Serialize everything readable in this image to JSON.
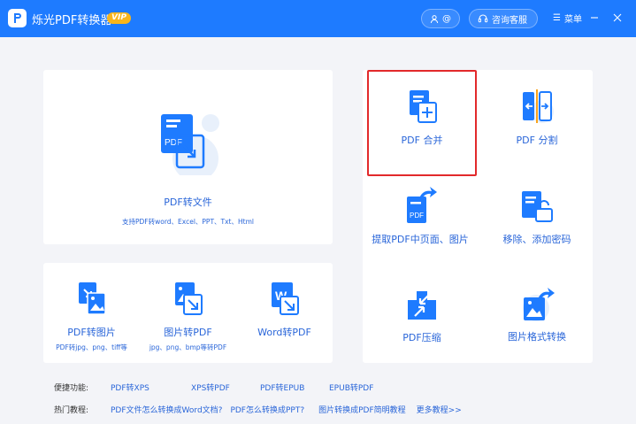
{
  "titlebar": {
    "app_title": "烁光PDF转换器",
    "vip_badge": "VIP",
    "account_label": "@",
    "support_label": "咨询客服",
    "menu_label": "菜单",
    "bg_color": "#1e7bff"
  },
  "main_card": {
    "label": "PDF转文件",
    "sub": "支持PDF转word、Excel、PPT、Txt、Html"
  },
  "small_tiles": [
    {
      "label": "PDF转图片",
      "sub": "PDF转jpg、png、tiff等"
    },
    {
      "label": "图片转PDF",
      "sub": "jpg、png、bmp等转PDF"
    },
    {
      "label": "Word转PDF",
      "sub": ""
    }
  ],
  "right_tiles": [
    {
      "label": "PDF 合并",
      "icon": "merge-pdf-icon"
    },
    {
      "label": "PDF 分割",
      "icon": "split-pdf-icon"
    },
    {
      "label": "提取PDF中页面、图片",
      "icon": "extract-pdf-icon"
    },
    {
      "label": "移除、添加密码",
      "icon": "password-icon"
    },
    {
      "label": "PDF压缩",
      "icon": "compress-pdf-icon"
    },
    {
      "label": "图片格式转换",
      "icon": "image-convert-icon"
    }
  ],
  "quick_functions": {
    "label": "便捷功能:",
    "links": [
      "PDF转XPS",
      "XPS转PDF",
      "PDF转EPUB",
      "EPUB转PDF"
    ]
  },
  "hot_tutorials": {
    "label": "热门教程:",
    "links": [
      "PDF文件怎么转换成Word文档?",
      "PDF怎么转换成PPT?",
      "图片转换成PDF简明教程",
      "更多教程>>"
    ]
  },
  "colors": {
    "accent": "#1e7bff",
    "link": "#2a66d9",
    "highlight": "#e2292b"
  }
}
